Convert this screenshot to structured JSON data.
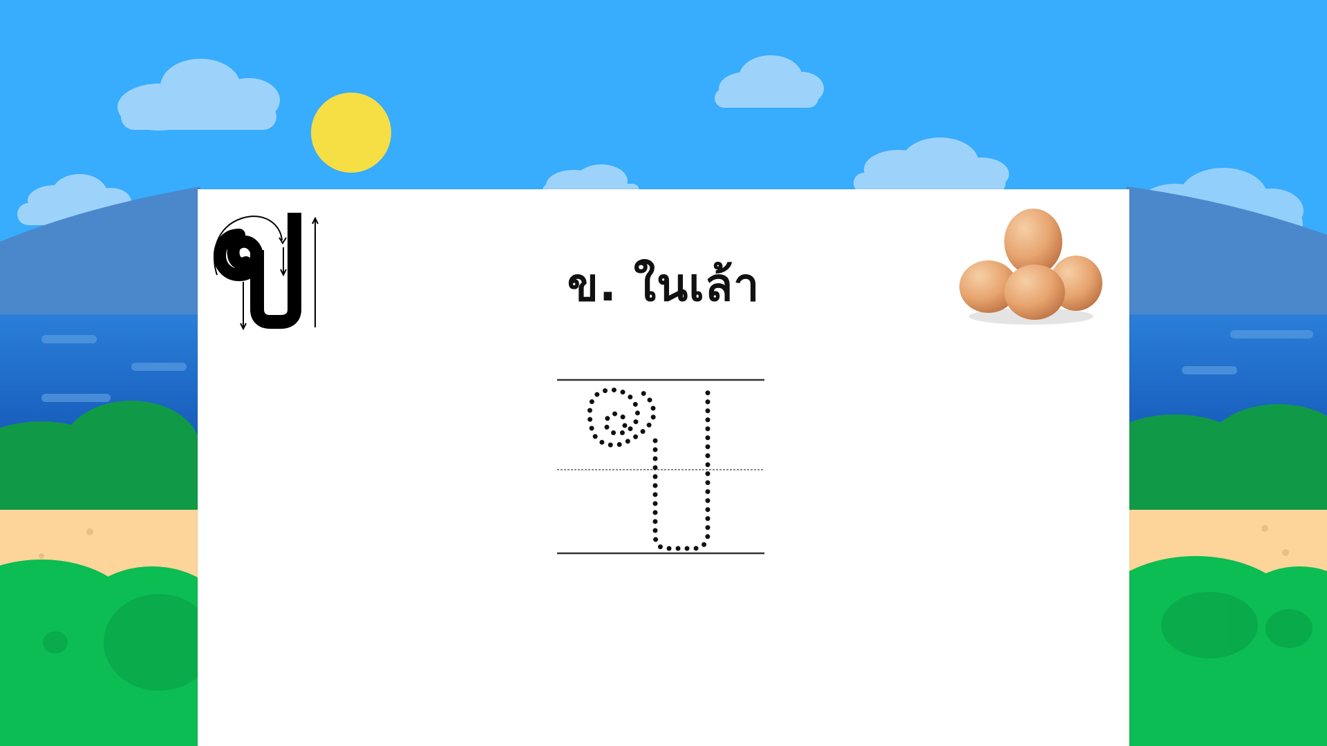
{
  "card": {
    "title": "ข. ในเล้า"
  },
  "letter": {
    "glyph": "ข",
    "guide_icon": "stroke-order-letter-icon",
    "trace_icon": "dotted-trace-letter-icon"
  },
  "picture": {
    "icon": "eggs-icon"
  },
  "colors": {
    "sky": "#38acfd",
    "cloud": "#9dd3fb",
    "sun": "#f6de45",
    "mountain": "#4b88cb",
    "sea": "#1e6fd0",
    "sea_dark": "#1558b8",
    "bush_dark": "#109a47",
    "bush_light": "#0bbd52",
    "sand": "#fdd49a",
    "egg": "#e7a46f"
  }
}
